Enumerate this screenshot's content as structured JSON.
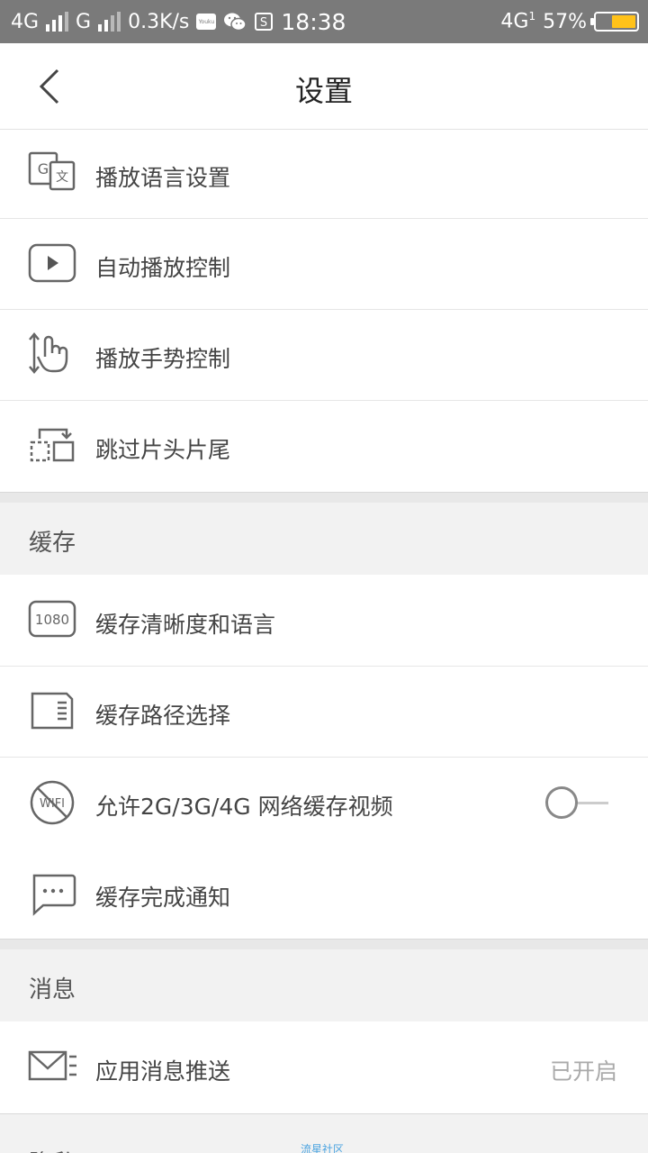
{
  "status_bar": {
    "net1": "4G",
    "net2": "G",
    "speed": "0.3K/s",
    "app_tiny": "Youku",
    "time": "18:38",
    "net3": "4G",
    "net3_sub": "1",
    "battery": "57%"
  },
  "header": {
    "title": "设置"
  },
  "rows_top": [
    {
      "label": "播放语言设置",
      "icon": "translate-icon"
    },
    {
      "label": "自动播放控制",
      "icon": "play-icon"
    },
    {
      "label": "播放手势控制",
      "icon": "gesture-icon"
    },
    {
      "label": "跳过片头片尾",
      "icon": "skip-icon"
    }
  ],
  "section_cache": {
    "title": "缓存"
  },
  "rows_cache": [
    {
      "label": "缓存清晰度和语言",
      "icon": "1080-icon",
      "icon_text": "1080"
    },
    {
      "label": "缓存路径选择",
      "icon": "sdcard-icon"
    },
    {
      "label": "允许2G/3G/4G 网络缓存视频",
      "icon": "no-wifi-icon",
      "icon_text": "WIFI",
      "toggle": "off"
    },
    {
      "label": "缓存完成通知",
      "icon": "message-icon"
    }
  ],
  "section_msg": {
    "title": "消息"
  },
  "rows_msg": [
    {
      "label": "应用消息推送",
      "icon": "mail-icon",
      "value": "已开启"
    }
  ],
  "watermark": "流星社区",
  "peek": {
    "text": "隐私"
  }
}
